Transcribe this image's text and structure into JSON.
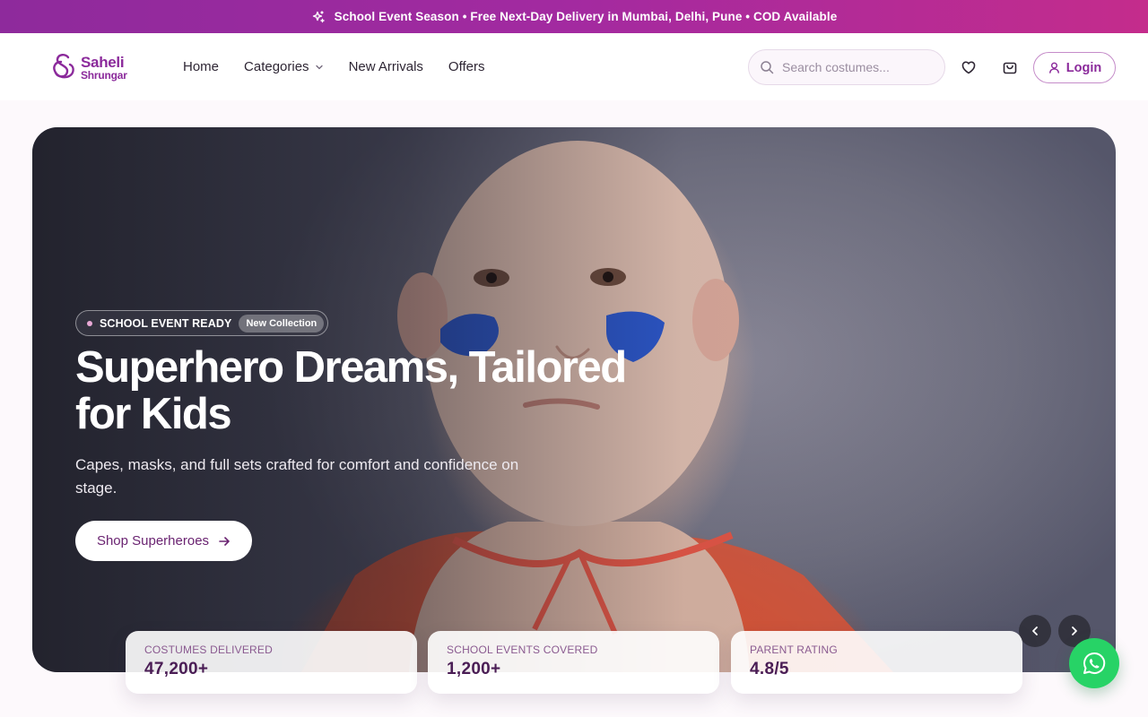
{
  "announcement": {
    "text": "School Event Season • Free Next-Day Delivery in Mumbai, Delhi, Pune • COD Available",
    "icon": "sparkle-icon"
  },
  "brand": {
    "name_line1": "Saheli",
    "name_line2": "Shrungar",
    "color": "#8b2a9b"
  },
  "nav": {
    "home": "Home",
    "categories": "Categories",
    "new_arrivals": "New Arrivals",
    "offers": "Offers"
  },
  "search": {
    "placeholder": "Search costumes..."
  },
  "header_actions": {
    "login": "Login"
  },
  "hero": {
    "badge_label": "SCHOOL EVENT READY",
    "badge_pill": "New Collection",
    "title": "Superhero Dreams, Tailored for Kids",
    "subtitle": "Capes, masks, and full sets crafted for comfort and confidence on stage.",
    "cta": "Shop Superheroes"
  },
  "stats": [
    {
      "label": "COSTUMES DELIVERED",
      "value": "47,200+"
    },
    {
      "label": "SCHOOL EVENTS COVERED",
      "value": "1,200+"
    },
    {
      "label": "PARENT RATING",
      "value": "4.8/5"
    }
  ],
  "colors": {
    "accent": "#8b2a9b",
    "announce_start": "#8e2a9c",
    "announce_end": "#c42c8c",
    "whatsapp": "#27d366"
  }
}
